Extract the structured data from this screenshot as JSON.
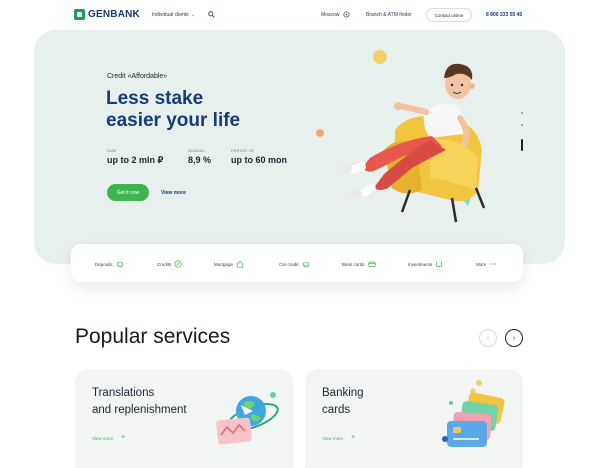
{
  "header": {
    "logo": "GENBANK",
    "nav_clients": "Individual clients",
    "city": "Moscow",
    "branch": "Branch & ATM finder",
    "contact_btn": "Contact online",
    "phone": "8 800 333 55 45"
  },
  "hero": {
    "subtitle": "Credit «Affordable»",
    "title_line1": "Less stake",
    "title_line2": "easier your life",
    "stats": [
      {
        "label": "SUM",
        "value": "up to 2 mln ₽"
      },
      {
        "label": "ANNUAL",
        "value": "8,9 %"
      },
      {
        "label": "PERIOD OF",
        "value": "up to 60 mon"
      }
    ],
    "get_btn": "Get it now",
    "view_more": "View more"
  },
  "categories": [
    {
      "label": "Deposits",
      "icon": "piggy-bank-icon"
    },
    {
      "label": "Credits",
      "icon": "percent-circle-icon"
    },
    {
      "label": "Mortgage",
      "icon": "house-icon"
    },
    {
      "label": "Car credit",
      "icon": "car-icon"
    },
    {
      "label": "Bank cards",
      "icon": "card-icon"
    },
    {
      "label": "Investments",
      "icon": "chart-icon"
    },
    {
      "label": "More",
      "icon": "more-dots-icon"
    }
  ],
  "services": {
    "title": "Popular services",
    "cards": [
      {
        "title_line1": "Translations",
        "title_line2": "and replenishment",
        "more": "View more"
      },
      {
        "title_line1": "Banking",
        "title_line2": "cards",
        "more": "View more"
      }
    ]
  },
  "colors": {
    "brand_blue": "#143c78",
    "brand_green": "#3fb34f",
    "hero_bg": "#e8f0ed"
  }
}
